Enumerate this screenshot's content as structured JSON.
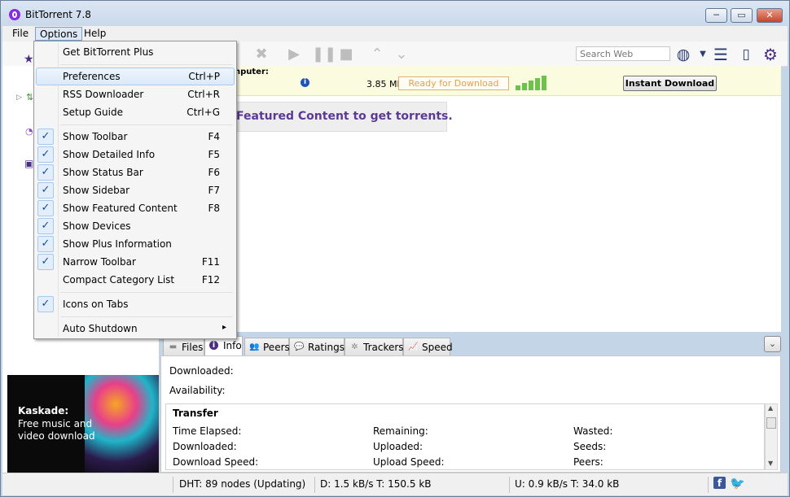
{
  "window": {
    "title": "BitTorrent 7.8",
    "min": "─",
    "max": "▭",
    "close": "✕"
  },
  "menubar": {
    "file": "File",
    "options": "Options",
    "help": "Help"
  },
  "toolbar": {
    "search_placeholder": "Search Web"
  },
  "plus": {
    "computer_label": "nputer:",
    "size": "3.85 MB",
    "status": "Ready for Download",
    "instant_button": "Instant Download"
  },
  "main": {
    "featured_text": "Featured Content to get torrents."
  },
  "options_menu": {
    "get_plus": "Get BitTorrent Plus",
    "items_group1": [
      {
        "label": "Preferences",
        "shortcut": "Ctrl+P"
      },
      {
        "label": "RSS Downloader",
        "shortcut": "Ctrl+R"
      },
      {
        "label": "Setup Guide",
        "shortcut": "Ctrl+G"
      }
    ],
    "items_group2": [
      {
        "label": "Show Toolbar",
        "shortcut": "F4",
        "checked": true
      },
      {
        "label": "Show Detailed Info",
        "shortcut": "F5",
        "checked": true
      },
      {
        "label": "Show Status Bar",
        "shortcut": "F6",
        "checked": true
      },
      {
        "label": "Show Sidebar",
        "shortcut": "F7",
        "checked": true
      },
      {
        "label": "Show Featured Content",
        "shortcut": "F8",
        "checked": true
      },
      {
        "label": "Show Devices",
        "shortcut": "",
        "checked": true
      },
      {
        "label": "Show Plus Information",
        "shortcut": "",
        "checked": true
      },
      {
        "label": "Narrow Toolbar",
        "shortcut": "F11",
        "checked": true
      },
      {
        "label": "Compact Category List",
        "shortcut": "F12",
        "checked": false
      }
    ],
    "icons_on_tabs": {
      "label": "Icons on Tabs",
      "checked": true
    },
    "auto_shutdown": {
      "label": "Auto Shutdown",
      "arrow": "▸"
    },
    "check_glyph": "✓"
  },
  "tabs": [
    "Files",
    "Info",
    "Peers",
    "Ratings",
    "Trackers",
    "Speed"
  ],
  "details": {
    "downloaded_label": "Downloaded:",
    "availability_label": "Availability:",
    "transfer_title": "Transfer",
    "transfer_rows": [
      [
        "Time Elapsed:",
        "Remaining:",
        "Wasted:"
      ],
      [
        "Downloaded:",
        "Uploaded:",
        "Seeds:"
      ],
      [
        "Download Speed:",
        "Upload Speed:",
        "Peers:"
      ]
    ]
  },
  "ad": {
    "title": "Kaskade:",
    "line1": "Free music and",
    "line2": "video download"
  },
  "statusbar": {
    "dht": "DHT: 89 nodes (Updating)",
    "down": "D: 1.5 kB/s T: 150.5 kB",
    "up": "U: 0.9 kB/s T: 34.0 kB",
    "facebook": "f",
    "twitter": "🐦"
  },
  "colors": {
    "accent_purple": "#5b3a95",
    "check_blue": "#1a4b9b",
    "ready_orange": "#e0a050",
    "signal_green": "#6cc24a"
  }
}
